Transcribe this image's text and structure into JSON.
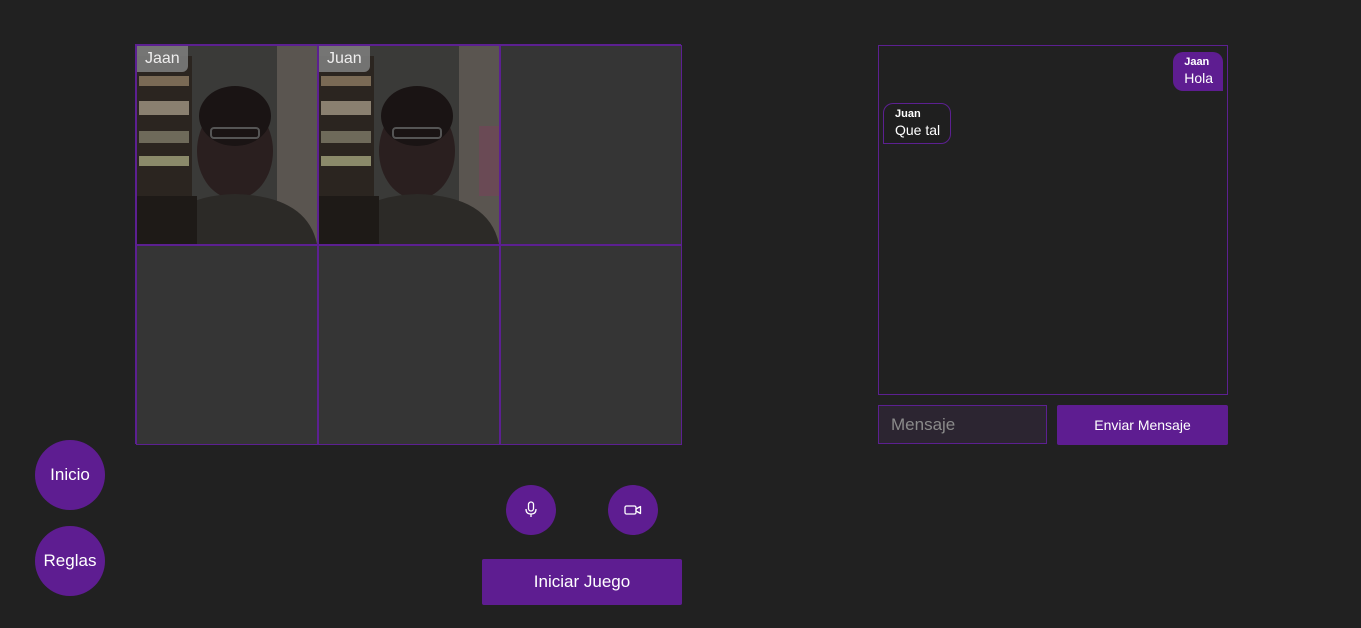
{
  "video_grid": {
    "tiles": [
      {
        "name": "Jaan",
        "has_video": true
      },
      {
        "name": "Juan",
        "has_video": true
      },
      {
        "name": "",
        "has_video": false
      },
      {
        "name": "",
        "has_video": false
      },
      {
        "name": "",
        "has_video": false
      },
      {
        "name": "",
        "has_video": false
      }
    ]
  },
  "nav": {
    "home_label": "Inicio",
    "rules_label": "Reglas"
  },
  "controls": {
    "mic_icon": "microphone-icon",
    "camera_icon": "video-camera-icon",
    "start_label": "Iniciar Juego"
  },
  "chat": {
    "messages": [
      {
        "author": "Jaan",
        "text": "Hola",
        "mine": true
      },
      {
        "author": "Juan",
        "text": "Que tal",
        "mine": false
      }
    ],
    "input": {
      "placeholder": "Mensaje",
      "value": ""
    },
    "send_label": "Enviar Mensaje"
  },
  "colors": {
    "background": "#212121",
    "accent": "#5e1d91",
    "border": "#5c2091",
    "empty_tile": "#353535"
  }
}
